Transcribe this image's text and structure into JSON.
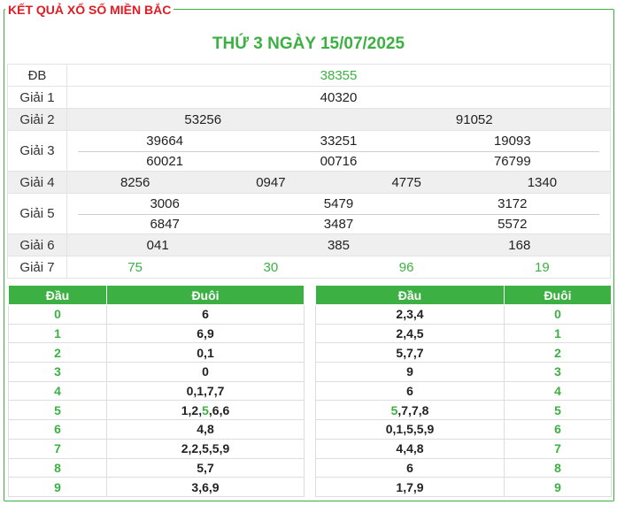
{
  "header": {
    "frame_title": "KẾT QUẢ XỔ SỐ MIỀN BẮC",
    "date_title": "THỨ 3 NGÀY 15/07/2025"
  },
  "results": {
    "db": {
      "label": "ĐB",
      "values": [
        "38355"
      ]
    },
    "g1": {
      "label": "Giải 1",
      "values": [
        "40320"
      ]
    },
    "g2": {
      "label": "Giải 2",
      "values": [
        "53256",
        "91052"
      ]
    },
    "g3": {
      "label": "Giải 3",
      "values": [
        "39664",
        "33251",
        "19093",
        "60021",
        "00716",
        "76799"
      ]
    },
    "g4": {
      "label": "Giải 4",
      "values": [
        "8256",
        "0947",
        "4775",
        "1340"
      ]
    },
    "g5": {
      "label": "Giải 5",
      "values": [
        "3006",
        "5479",
        "3172",
        "6847",
        "3487",
        "5572"
      ]
    },
    "g6": {
      "label": "Giải 6",
      "values": [
        "041",
        "385",
        "168"
      ]
    },
    "g7": {
      "label": "Giải 7",
      "values": [
        "75",
        "30",
        "96",
        "19"
      ]
    }
  },
  "loto_left": {
    "head_label": "Đầu",
    "tail_label": "Đuôi",
    "rows": [
      {
        "num": "0",
        "val": "6"
      },
      {
        "num": "1",
        "val": "6,9"
      },
      {
        "num": "2",
        "val": "0,1"
      },
      {
        "num": "3",
        "val": "0"
      },
      {
        "num": "4",
        "val": "0,1,7,7"
      },
      {
        "num": "5",
        "pre": "1,2,",
        "hl": "5",
        "post": ",6,6"
      },
      {
        "num": "6",
        "val": "4,8"
      },
      {
        "num": "7",
        "val": "2,2,5,5,9"
      },
      {
        "num": "8",
        "val": "5,7"
      },
      {
        "num": "9",
        "val": "3,6,9"
      }
    ]
  },
  "loto_right": {
    "head_label": "Đầu",
    "tail_label": "Đuôi",
    "rows": [
      {
        "num": "0",
        "val": "2,3,4"
      },
      {
        "num": "1",
        "val": "2,4,5"
      },
      {
        "num": "2",
        "val": "5,7,7"
      },
      {
        "num": "3",
        "val": "9"
      },
      {
        "num": "4",
        "val": "6"
      },
      {
        "num": "5",
        "pre": "",
        "hl": "5",
        "post": ",7,7,8"
      },
      {
        "num": "6",
        "val": "0,1,5,5,9"
      },
      {
        "num": "7",
        "val": "4,4,8"
      },
      {
        "num": "8",
        "val": "6"
      },
      {
        "num": "9",
        "val": "1,7,9"
      }
    ]
  },
  "colors": {
    "accent_green": "#3cb043",
    "title_red": "#e31b23",
    "row_shade": "#efefef"
  }
}
